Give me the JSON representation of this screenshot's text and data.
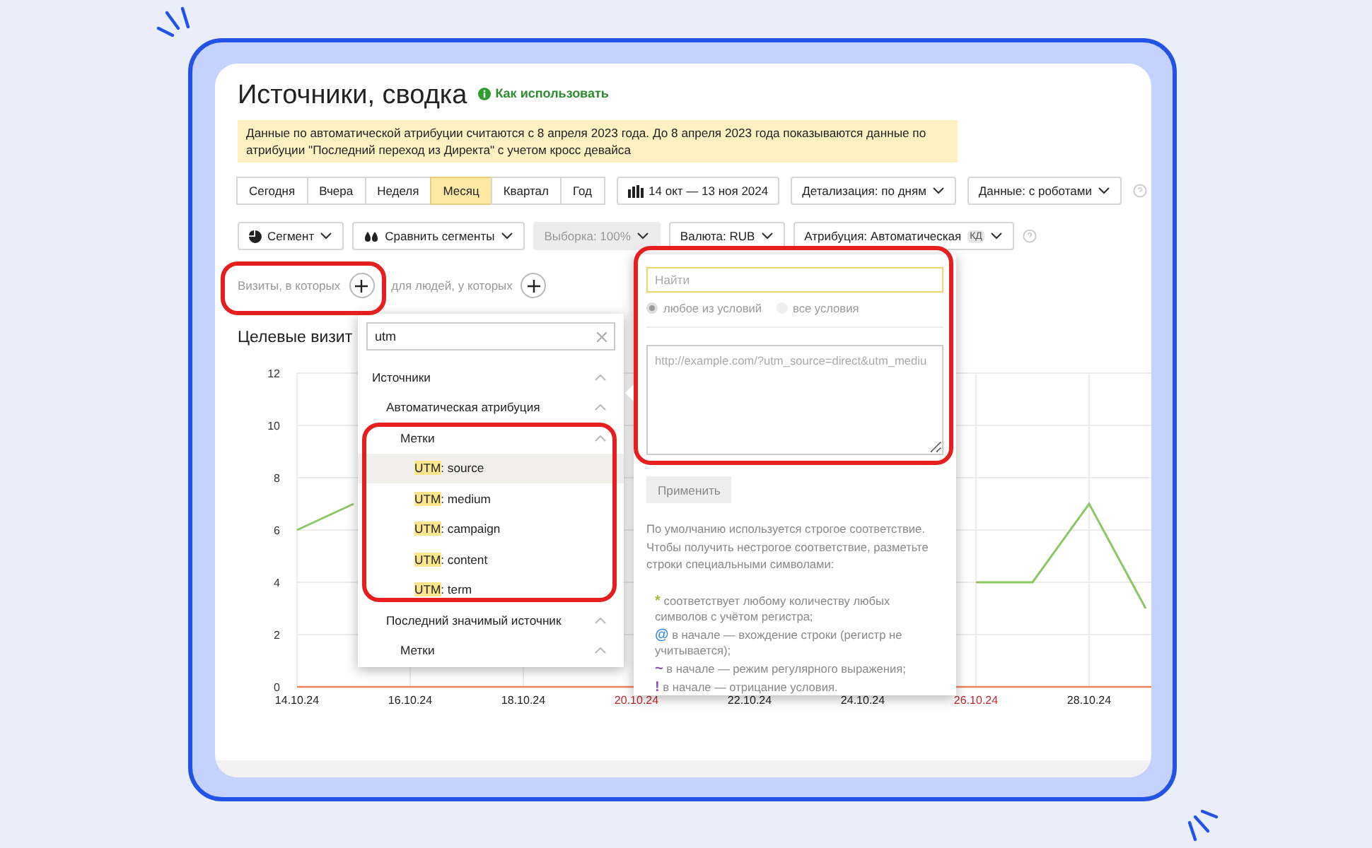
{
  "page": {
    "title": "Источники, сводка",
    "help_link": "Как использовать",
    "notice": "Данные по автоматической атрибуции считаются с 8 апреля 2023 года. До 8 апреля 2023 года показываются данные по атрибуции \"Последний переход из Директа\" с учетом кросс девайса"
  },
  "periods": [
    {
      "label": "Сегодня",
      "selected": false
    },
    {
      "label": "Вчера",
      "selected": false
    },
    {
      "label": "Неделя",
      "selected": false
    },
    {
      "label": "Месяц",
      "selected": true
    },
    {
      "label": "Квартал",
      "selected": false
    },
    {
      "label": "Год",
      "selected": false
    }
  ],
  "date_range": "14 окт — 13 ноя 2024",
  "dropdowns": [
    "Детализация: по дням",
    "Данные: с роботами"
  ],
  "toolbar": [
    {
      "kind": "pie",
      "label": "Сегмент",
      "disabled": false
    },
    {
      "kind": "drops",
      "label": "Сравнить сегменты",
      "disabled": false
    },
    {
      "kind": "plain",
      "label": "Выборка: 100%",
      "disabled": true
    },
    {
      "kind": "plain",
      "label": "Валюта: RUB",
      "disabled": false
    },
    {
      "kind": "badge",
      "label": "Атрибуция: Автоматическая",
      "badge": "КД",
      "disabled": false
    }
  ],
  "filters": [
    {
      "label": "Визиты, в которых"
    },
    {
      "label": "для людей, у которых"
    }
  ],
  "chart_title": "Целевые визит",
  "chart_data": {
    "type": "line",
    "categories": [
      "14.10.24",
      null,
      "16.10.24",
      null,
      "18.10.24",
      null,
      "20.10.24",
      null,
      "22.10.24",
      null,
      "24.10.24",
      null,
      "26.10.24",
      null,
      "28.10.24",
      null
    ],
    "series": [
      {
        "color": "#8cc665",
        "values": [
          6,
          7,
          null,
          null,
          null,
          null,
          null,
          null,
          null,
          null,
          null,
          null,
          4,
          4,
          7,
          3
        ]
      }
    ],
    "ylim": [
      0,
      12
    ],
    "yticks": [
      0,
      2,
      4,
      6,
      8,
      10,
      12
    ],
    "grid": true,
    "annotations": [
      {
        "x": "20.10.24"
      },
      {
        "x": "26.10.24"
      }
    ]
  },
  "dropdown": {
    "search": "utm",
    "tree": [
      {
        "label": "Источники",
        "expanded": true,
        "children": [
          {
            "label": "Автоматическая атрибуция",
            "expanded": true,
            "children": [
              {
                "label": "Метки",
                "expanded": true,
                "children": [
                  {
                    "match": "UTM",
                    "label": ": source",
                    "selected": true
                  },
                  {
                    "match": "UTM",
                    "label": ": medium",
                    "selected": false
                  },
                  {
                    "match": "UTM",
                    "label": ": campaign",
                    "selected": false
                  },
                  {
                    "match": "UTM",
                    "label": ": content",
                    "selected": false
                  },
                  {
                    "match": "UTM",
                    "label": ": term",
                    "selected": false
                  }
                ]
              }
            ]
          },
          {
            "label": "Последний значимый источник",
            "expanded": true,
            "children": [
              {
                "label": "Метки",
                "expanded": true
              }
            ]
          }
        ]
      }
    ]
  },
  "condition_panel": {
    "placeholder": "Найти",
    "modes": [
      {
        "label": "любое из условий",
        "selected": true
      },
      {
        "label": "все условия",
        "selected": false
      }
    ],
    "values_placeholder": "http://example.com/?utm_source=direct&utm_mediu",
    "apply": "Применить",
    "hint": "По умолчанию используется строгое соответствие. Чтобы получить нестрогое соответствие, разметьте строки специальными символами:",
    "rules": [
      {
        "symbol": "*",
        "text": " соответствует любому количеству любых символов с учётом регистра;",
        "color": "#a8b83a"
      },
      {
        "symbol": "@",
        "text": " в начале — вхождение строки (регистр не учитывается);",
        "color": "#3a8ee6"
      },
      {
        "symbol": "~",
        "text": " в начале — режим регулярного выражения;",
        "color": "#8a4fb8"
      },
      {
        "symbol": "!",
        "text": " в начале — отрицание условия.",
        "color": "#8a4fb8"
      }
    ]
  }
}
